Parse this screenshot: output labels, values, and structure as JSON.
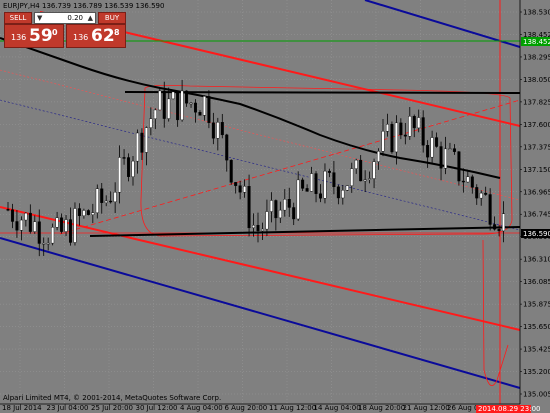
{
  "header": {
    "symbol_line": "EURJPY,H4  136.739 136.789 136.539 136.590"
  },
  "trade_panel": {
    "sell_label": "SELL",
    "buy_label": "BUY",
    "lot_value": "0.20",
    "sell_price_prefix": "136",
    "sell_price_big": "59",
    "sell_price_sup": "0",
    "buy_price_prefix": "136",
    "buy_price_big": "62",
    "buy_price_sup": "8"
  },
  "price_axis": {
    "labels": [
      "136.739",
      "138.530",
      "138.452",
      "138.295",
      "138.050",
      "137.825",
      "137.600",
      "137.375",
      "137.150",
      "136.965",
      "136.745",
      "136.590",
      "136.310",
      "136.085",
      "135.875",
      "135.650",
      "135.425",
      "135.200",
      "135.005"
    ],
    "current_price": "136.590",
    "green_line_price": "138.452"
  },
  "time_axis": {
    "labels": [
      "18 Jul 2014",
      "23 Jul 04:00",
      "25 Jul 20:00",
      "30 Jul 12:00",
      "4 Aug 04:00",
      "6 Aug 20:00",
      "11 Aug 12:00",
      "14 Aug 04:00",
      "18 Aug 20:00",
      "21 Aug 12:00",
      "26 Aug 04:00"
    ],
    "current_time": "2014.08.29 23:00"
  },
  "footer": {
    "copyright": "Alpari Limited MT4, © 2001-2014, MetaQuotes Software Corp."
  },
  "colors": {
    "background": "#808080",
    "channel_red": "#ff1a1a",
    "channel_blue": "#0a0a9a",
    "moving_average": "#000000",
    "green_level": "#00a000",
    "current_price_bg": "#000000"
  },
  "chart_data": {
    "type": "candlestick",
    "symbol": "EURJPY",
    "timeframe": "H4",
    "x_categories": [
      "18 Jul 2014",
      "23 Jul 04:00",
      "25 Jul 20:00",
      "30 Jul 12:00",
      "4 Aug 04:00",
      "6 Aug 20:00",
      "11 Aug 12:00",
      "14 Aug 04:00",
      "18 Aug 20:00",
      "21 Aug 12:00",
      "26 Aug 04:00"
    ],
    "close_approx": [
      136.8,
      136.55,
      136.9,
      137.75,
      137.8,
      136.6,
      136.95,
      137.1,
      137.6,
      137.2,
      136.7
    ],
    "ylim": [
      135.005,
      138.73
    ],
    "last_price": 136.59
  }
}
